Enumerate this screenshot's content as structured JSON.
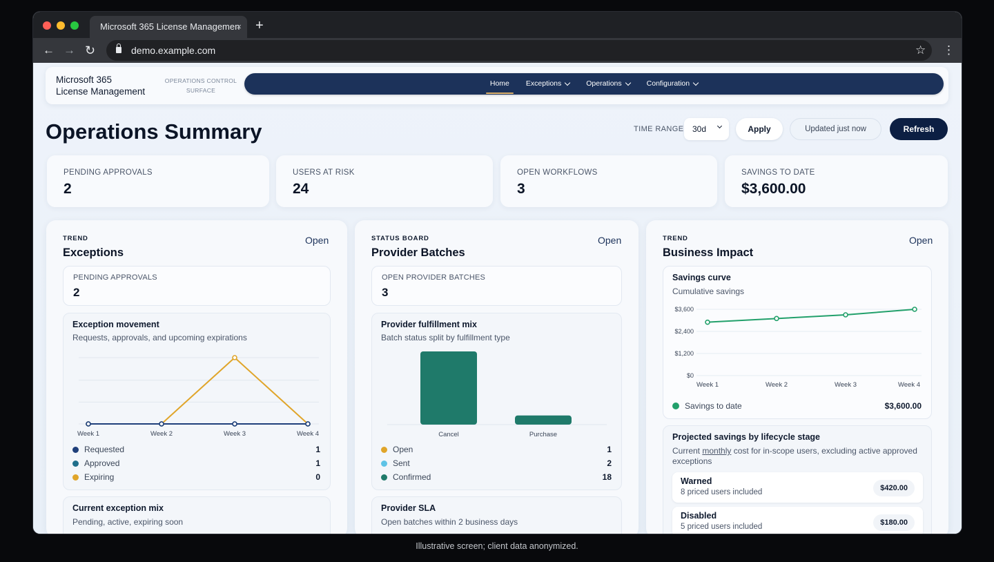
{
  "browser": {
    "tab_title": "Microsoft 365 License Managemen",
    "tab_close": "×",
    "new_tab": "+",
    "url": "demo.example.com",
    "back": "←",
    "forward": "→",
    "reload": "↻",
    "star": "☆",
    "menu": "⋮",
    "traffic_colors": [
      "#ff5f57",
      "#febc2e",
      "#28c840"
    ]
  },
  "app": {
    "brand_line1": "Microsoft 365",
    "brand_line2": "License Management",
    "surface_line1": "OPERATIONS CONTROL",
    "surface_line2": "SURFACE",
    "nav": [
      {
        "label": "Home",
        "active": true
      },
      {
        "label": "Exceptions"
      },
      {
        "label": "Operations"
      },
      {
        "label": "Configuration"
      }
    ]
  },
  "header": {
    "title": "Operations Summary",
    "time_range_label": "TIME RANGE",
    "time_range_value": "30d",
    "apply": "Apply",
    "updated": "Updated just now",
    "refresh": "Refresh"
  },
  "kpis": [
    {
      "label": "PENDING APPROVALS",
      "value": "2"
    },
    {
      "label": "USERS AT RISK",
      "value": "24"
    },
    {
      "label": "OPEN WORKFLOWS",
      "value": "3"
    },
    {
      "label": "SAVINGS TO DATE",
      "value": "$3,600.00"
    }
  ],
  "panels": {
    "exceptions": {
      "eyebrow": "TREND",
      "title": "Exceptions",
      "link": "Open",
      "metric_label": "PENDING APPROVALS",
      "metric_value": "2",
      "chart_title": "Exception movement",
      "chart_sub": "Requests, approvals, and upcoming expirations",
      "legend": [
        {
          "name": "Requested",
          "value": "1",
          "color": "#1f3f7a"
        },
        {
          "name": "Approved",
          "value": "1",
          "color": "#1f6f8b"
        },
        {
          "name": "Expiring",
          "value": "0",
          "color": "#e0a52a"
        }
      ],
      "mix_title": "Current exception mix",
      "mix_sub": "Pending, active, expiring soon"
    },
    "provider": {
      "eyebrow": "STATUS BOARD",
      "title": "Provider Batches",
      "link": "Open",
      "metric_label": "OPEN PROVIDER BATCHES",
      "metric_value": "3",
      "chart_title": "Provider fulfillment mix",
      "chart_sub": "Batch status split by fulfillment type",
      "legend": [
        {
          "name": "Open",
          "value": "1",
          "color": "#e0a52a"
        },
        {
          "name": "Sent",
          "value": "2",
          "color": "#5ec3e6"
        },
        {
          "name": "Confirmed",
          "value": "18",
          "color": "#1f7a6a"
        }
      ],
      "sla_title": "Provider SLA",
      "sla_sub": "Open batches within 2 business days"
    },
    "impact": {
      "eyebrow": "TREND",
      "title": "Business Impact",
      "link": "Open",
      "chart_title": "Savings curve",
      "chart_sub": "Cumulative savings",
      "legend_name": "Savings to date",
      "legend_value": "$3,600.00",
      "legend_color": "#22a06b",
      "proj_title": "Projected savings by lifecycle stage",
      "proj_sub_1": "Current ",
      "proj_sub_em": "monthly",
      "proj_sub_2": " cost for in-scope users, excluding active approved exceptions",
      "stages": [
        {
          "name": "Warned",
          "sub": "8 priced users included",
          "amount": "$420.00"
        },
        {
          "name": "Disabled",
          "sub": "5 priced users included",
          "amount": "$180.00"
        }
      ]
    }
  },
  "chart_data": [
    {
      "type": "line",
      "title": "Exception movement",
      "categories": [
        "Week 1",
        "Week 2",
        "Week 3",
        "Week 4"
      ],
      "series": [
        {
          "name": "Requested",
          "values": [
            0,
            0,
            0,
            0
          ],
          "color": "#1f3f7a"
        },
        {
          "name": "Approved",
          "values": [
            0,
            0,
            0,
            0
          ],
          "color": "#1f6f8b"
        },
        {
          "name": "Expiring",
          "values": [
            0,
            0,
            1,
            0
          ],
          "color": "#e0a52a"
        }
      ],
      "ylim": [
        0,
        1
      ],
      "grid": true
    },
    {
      "type": "bar",
      "title": "Provider fulfillment mix",
      "categories": [
        "Cancel",
        "Purchase"
      ],
      "values": [
        16,
        2
      ],
      "color": "#1f7a6a",
      "ylim": [
        0,
        16
      ]
    },
    {
      "type": "line",
      "title": "Savings curve",
      "categories": [
        "Week 1",
        "Week 2",
        "Week 3",
        "Week 4"
      ],
      "series": [
        {
          "name": "Savings to date",
          "values": [
            2900,
            3100,
            3300,
            3600
          ],
          "color": "#22a06b"
        }
      ],
      "yticks": [
        "$0",
        "$1,200",
        "$2,400",
        "$3,600"
      ],
      "ylim": [
        0,
        3600
      ],
      "grid": true
    }
  ],
  "footer": {
    "caption": "Illustrative screen; client data anonymized."
  }
}
